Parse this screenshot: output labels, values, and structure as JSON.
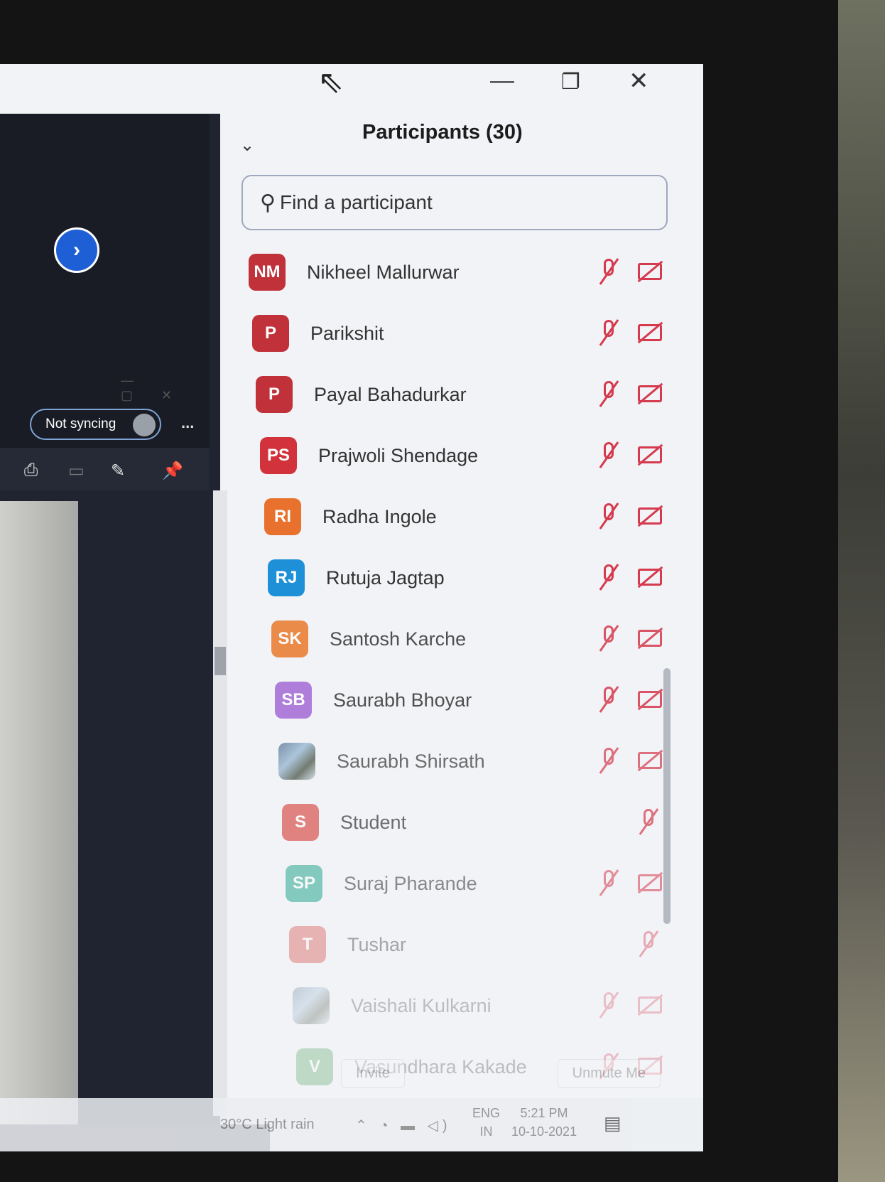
{
  "panel": {
    "title": "Participants (30)",
    "search_placeholder": "Find a participant",
    "participants": [
      {
        "initials": "NM",
        "name": "Nikheel Mallurwar",
        "color": "#c0313a",
        "mic": "muted",
        "video": "off"
      },
      {
        "initials": "P",
        "name": "Parikshit",
        "color": "#c0313a",
        "mic": "muted",
        "video": "off"
      },
      {
        "initials": "P",
        "name": "Payal Bahadurkar",
        "color": "#c0313a",
        "mic": "muted",
        "video": "off"
      },
      {
        "initials": "PS",
        "name": "Prajwoli Shendage",
        "color": "#d1323c",
        "mic": "muted",
        "video": "off"
      },
      {
        "initials": "RI",
        "name": "Radha Ingole",
        "color": "#e8722d",
        "mic": "muted",
        "video": "off"
      },
      {
        "initials": "RJ",
        "name": "Rutuja Jagtap",
        "color": "#1e90d8",
        "mic": "muted",
        "video": "off"
      },
      {
        "initials": "SK",
        "name": "Santosh Karche",
        "color": "#ea7a2c",
        "mic": "muted",
        "video": "off"
      },
      {
        "initials": "SB",
        "name": "Saurabh Bhoyar",
        "color": "#a36ad6",
        "mic": "muted",
        "video": "off"
      },
      {
        "initials": "",
        "name": "Saurabh Shirsath",
        "color": "#6a8aa8",
        "mic": "muted",
        "video": "off"
      },
      {
        "initials": "S",
        "name": "Student",
        "color": "#d9554f",
        "mic": "muted",
        "video": ""
      },
      {
        "initials": "SP",
        "name": "Suraj Pharande",
        "color": "#2aa88f",
        "mic": "muted",
        "video": "off"
      },
      {
        "initials": "T",
        "name": "Tushar",
        "color": "#d9554f",
        "mic": "muted",
        "video": ""
      },
      {
        "initials": "",
        "name": "Vaishali Kulkarni",
        "color": "#e8e2d8",
        "mic": "muted",
        "video": "off"
      },
      {
        "initials": "V",
        "name": "Vasundhara Kakade",
        "color": "#3a9a4e",
        "mic": "muted",
        "video": "off"
      }
    ],
    "invite_label": "Invite",
    "unmute_label": "Unmute Me"
  },
  "left": {
    "sync_label": "Not syncing",
    "more_label": "..."
  },
  "taskbar": {
    "weather": "30°C  Light rain",
    "lang_line1": "ENG",
    "lang_line2": "IN",
    "time": "5:21 PM",
    "date": "10-10-2021"
  },
  "colors": {
    "muted_icon": "#d53a4e",
    "accent_blue": "#1f5fd6"
  }
}
